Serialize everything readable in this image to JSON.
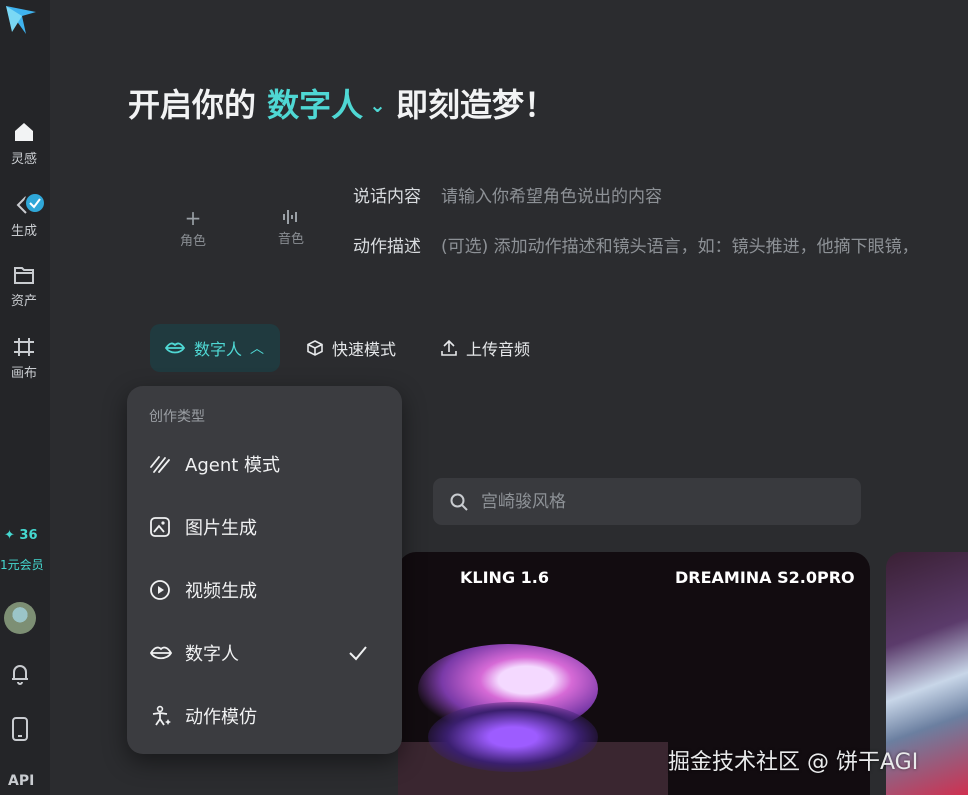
{
  "sidebar": {
    "items": [
      {
        "label": "灵感",
        "icon": "home-icon"
      },
      {
        "label": "生成",
        "icon": "generate-icon"
      },
      {
        "label": "资产",
        "icon": "folder-icon"
      },
      {
        "label": "画布",
        "icon": "canvas-icon"
      }
    ],
    "credits": "✦ 36",
    "membership": "1元会员",
    "api_label": "API"
  },
  "headline": {
    "prefix": "开启你的",
    "accent": "数字人",
    "suffix": "即刻造梦！"
  },
  "slots": [
    {
      "icon": "plus-icon",
      "label": "角色"
    },
    {
      "icon": "audio-wave-icon",
      "label": "音色"
    }
  ],
  "form": {
    "speech_label": "说话内容",
    "speech_placeholder": "请输入你希望角色说出的内容",
    "action_label": "动作描述",
    "action_placeholder": "(可选) 添加动作描述和镜头语言，如：镜头推进，他摘下眼镜，"
  },
  "toolbar": {
    "mode_label": "数字人",
    "quick_label": "快速模式",
    "upload_label": "上传音频"
  },
  "dropdown": {
    "title": "创作类型",
    "items": [
      {
        "label": "Agent 模式",
        "icon": "agent-icon"
      },
      {
        "label": "图片生成",
        "icon": "image-gen-icon"
      },
      {
        "label": "视频生成",
        "icon": "video-gen-icon"
      },
      {
        "label": "数字人",
        "icon": "lips-icon",
        "selected": true
      },
      {
        "label": "动作模仿",
        "icon": "motion-icon"
      }
    ]
  },
  "search": {
    "placeholder": "宫崎骏风格"
  },
  "card": {
    "tag_left": "KLING 1.6",
    "tag_right": "DREAMINA S2.0PRO"
  },
  "watermark": "掘金技术社区 @ 饼干AGI",
  "colors": {
    "accent": "#4fd8d4",
    "background": "#2b2c2f",
    "panel": "#3b3c40"
  }
}
